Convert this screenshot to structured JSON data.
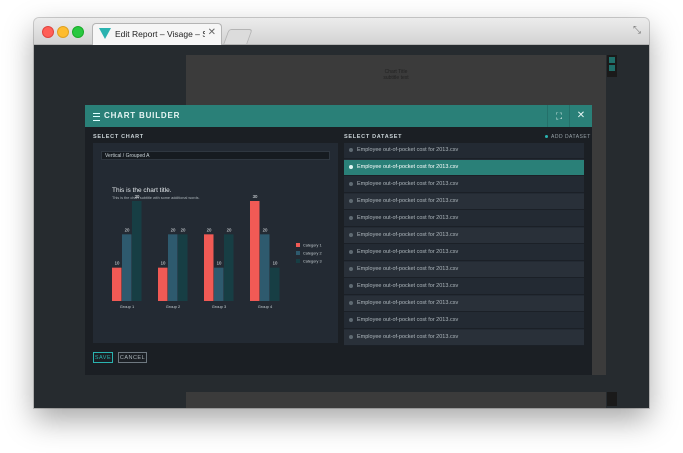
{
  "browser": {
    "tab_title": "Edit Report – Visage – Stag",
    "tab_close": "✕",
    "resize_glyph": "⤡"
  },
  "background_page": {
    "chart_title": "Chart Title",
    "chart_subtitle": "subtitle text"
  },
  "modal": {
    "title": "CHART BUILDER",
    "expand_glyph": "⛶",
    "close_glyph": "✕",
    "select_chart_label": "SELECT CHART",
    "select_dataset_label": "SELECT DATASET",
    "add_dataset_label": "ADD DATASET",
    "chart_type_value": "Vertical / Grouped A",
    "save_label": "SAVE",
    "cancel_label": "CANCEL",
    "datasets": [
      "Employee out-of-pocket cost for 2013.csv",
      "Employee out-of-pocket cost for 2013.csv",
      "Employee out-of-pocket cost for 2013.csv",
      "Employee out-of-pocket cost for 2013.csv",
      "Employee out-of-pocket cost for 2013.csv",
      "Employee out-of-pocket cost for 2013.csv",
      "Employee out-of-pocket cost for 2013.csv",
      "Employee out-of-pocket cost for 2013.csv",
      "Employee out-of-pocket cost for 2013.csv",
      "Employee out-of-pocket cost for 2013.csv",
      "Employee out-of-pocket cost for 2013.csv",
      "Employee out-of-pocket cost for 2013.csv"
    ],
    "selected_dataset_index": 1
  },
  "colors": {
    "accent": "#2a8078",
    "category_1": "#f15a55",
    "category_2": "#2e5a6e",
    "category_3": "#173e44"
  },
  "chart_data": {
    "type": "bar",
    "title": "This is the chart title.",
    "subtitle": "This is the chart subtitle with some additional words.",
    "categories": [
      "Group 1",
      "Group 2",
      "Group 3",
      "Group 4"
    ],
    "series": [
      {
        "name": "Category 1",
        "values": [
          10,
          10,
          20,
          30
        ]
      },
      {
        "name": "Category 2",
        "values": [
          20,
          20,
          10,
          20
        ]
      },
      {
        "name": "Category 3",
        "values": [
          30,
          20,
          20,
          10
        ]
      }
    ],
    "ylim": [
      0,
      30
    ],
    "legend": "right",
    "grid": false
  }
}
